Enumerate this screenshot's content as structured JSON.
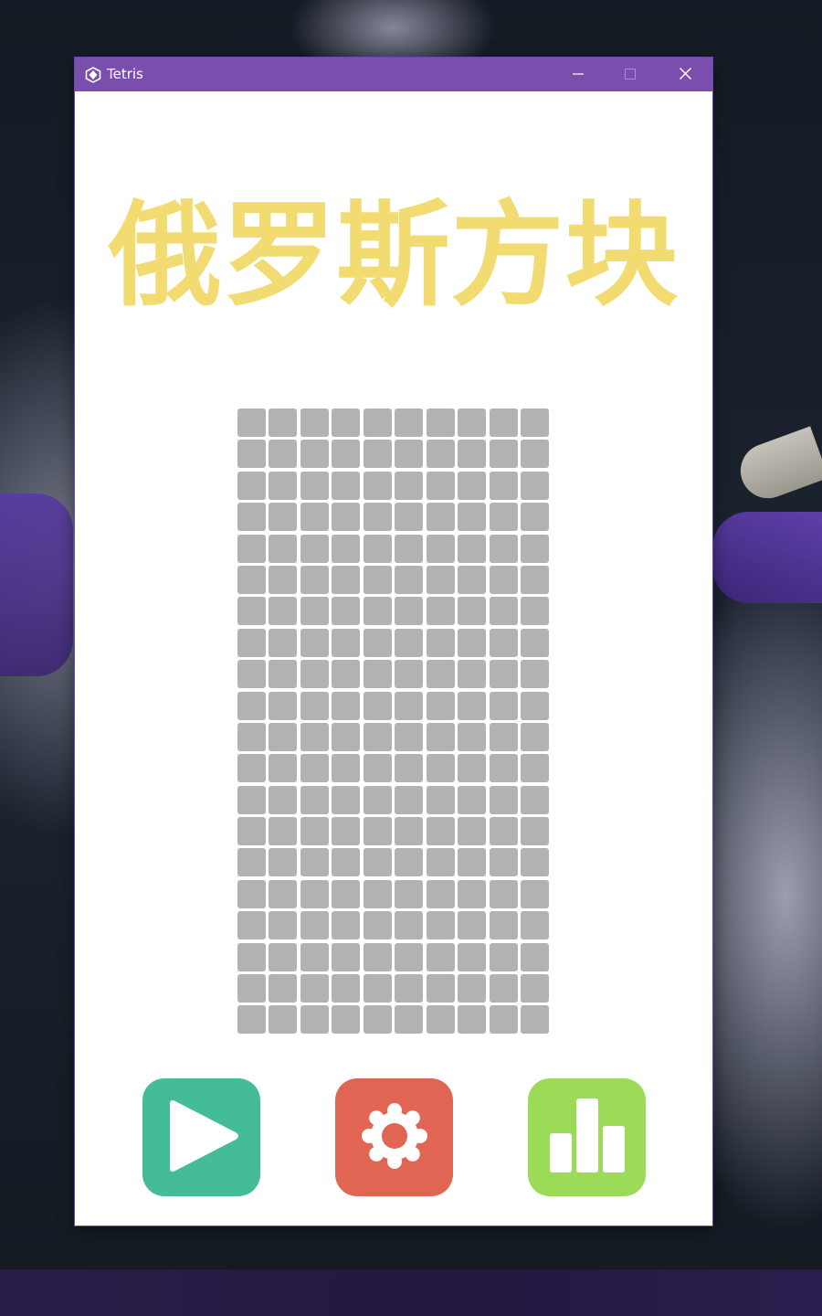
{
  "window": {
    "title": "Tetris",
    "icon": "unity-icon",
    "controls": [
      "minimize-icon",
      "maximize-icon",
      "close-icon"
    ],
    "titlebar_color": "#7a4ead"
  },
  "main": {
    "game_title": "俄罗斯方块",
    "title_color": "#f2dc72",
    "board": {
      "columns": 10,
      "rows": 20,
      "cell_color": "#b3b1b3"
    }
  },
  "buttons": [
    {
      "name": "play",
      "icon": "play-icon",
      "color": "#45bc99"
    },
    {
      "name": "settings",
      "icon": "gear-icon",
      "color": "#e06552"
    },
    {
      "name": "stats",
      "icon": "bar-chart-icon",
      "color": "#9bdb57"
    }
  ]
}
